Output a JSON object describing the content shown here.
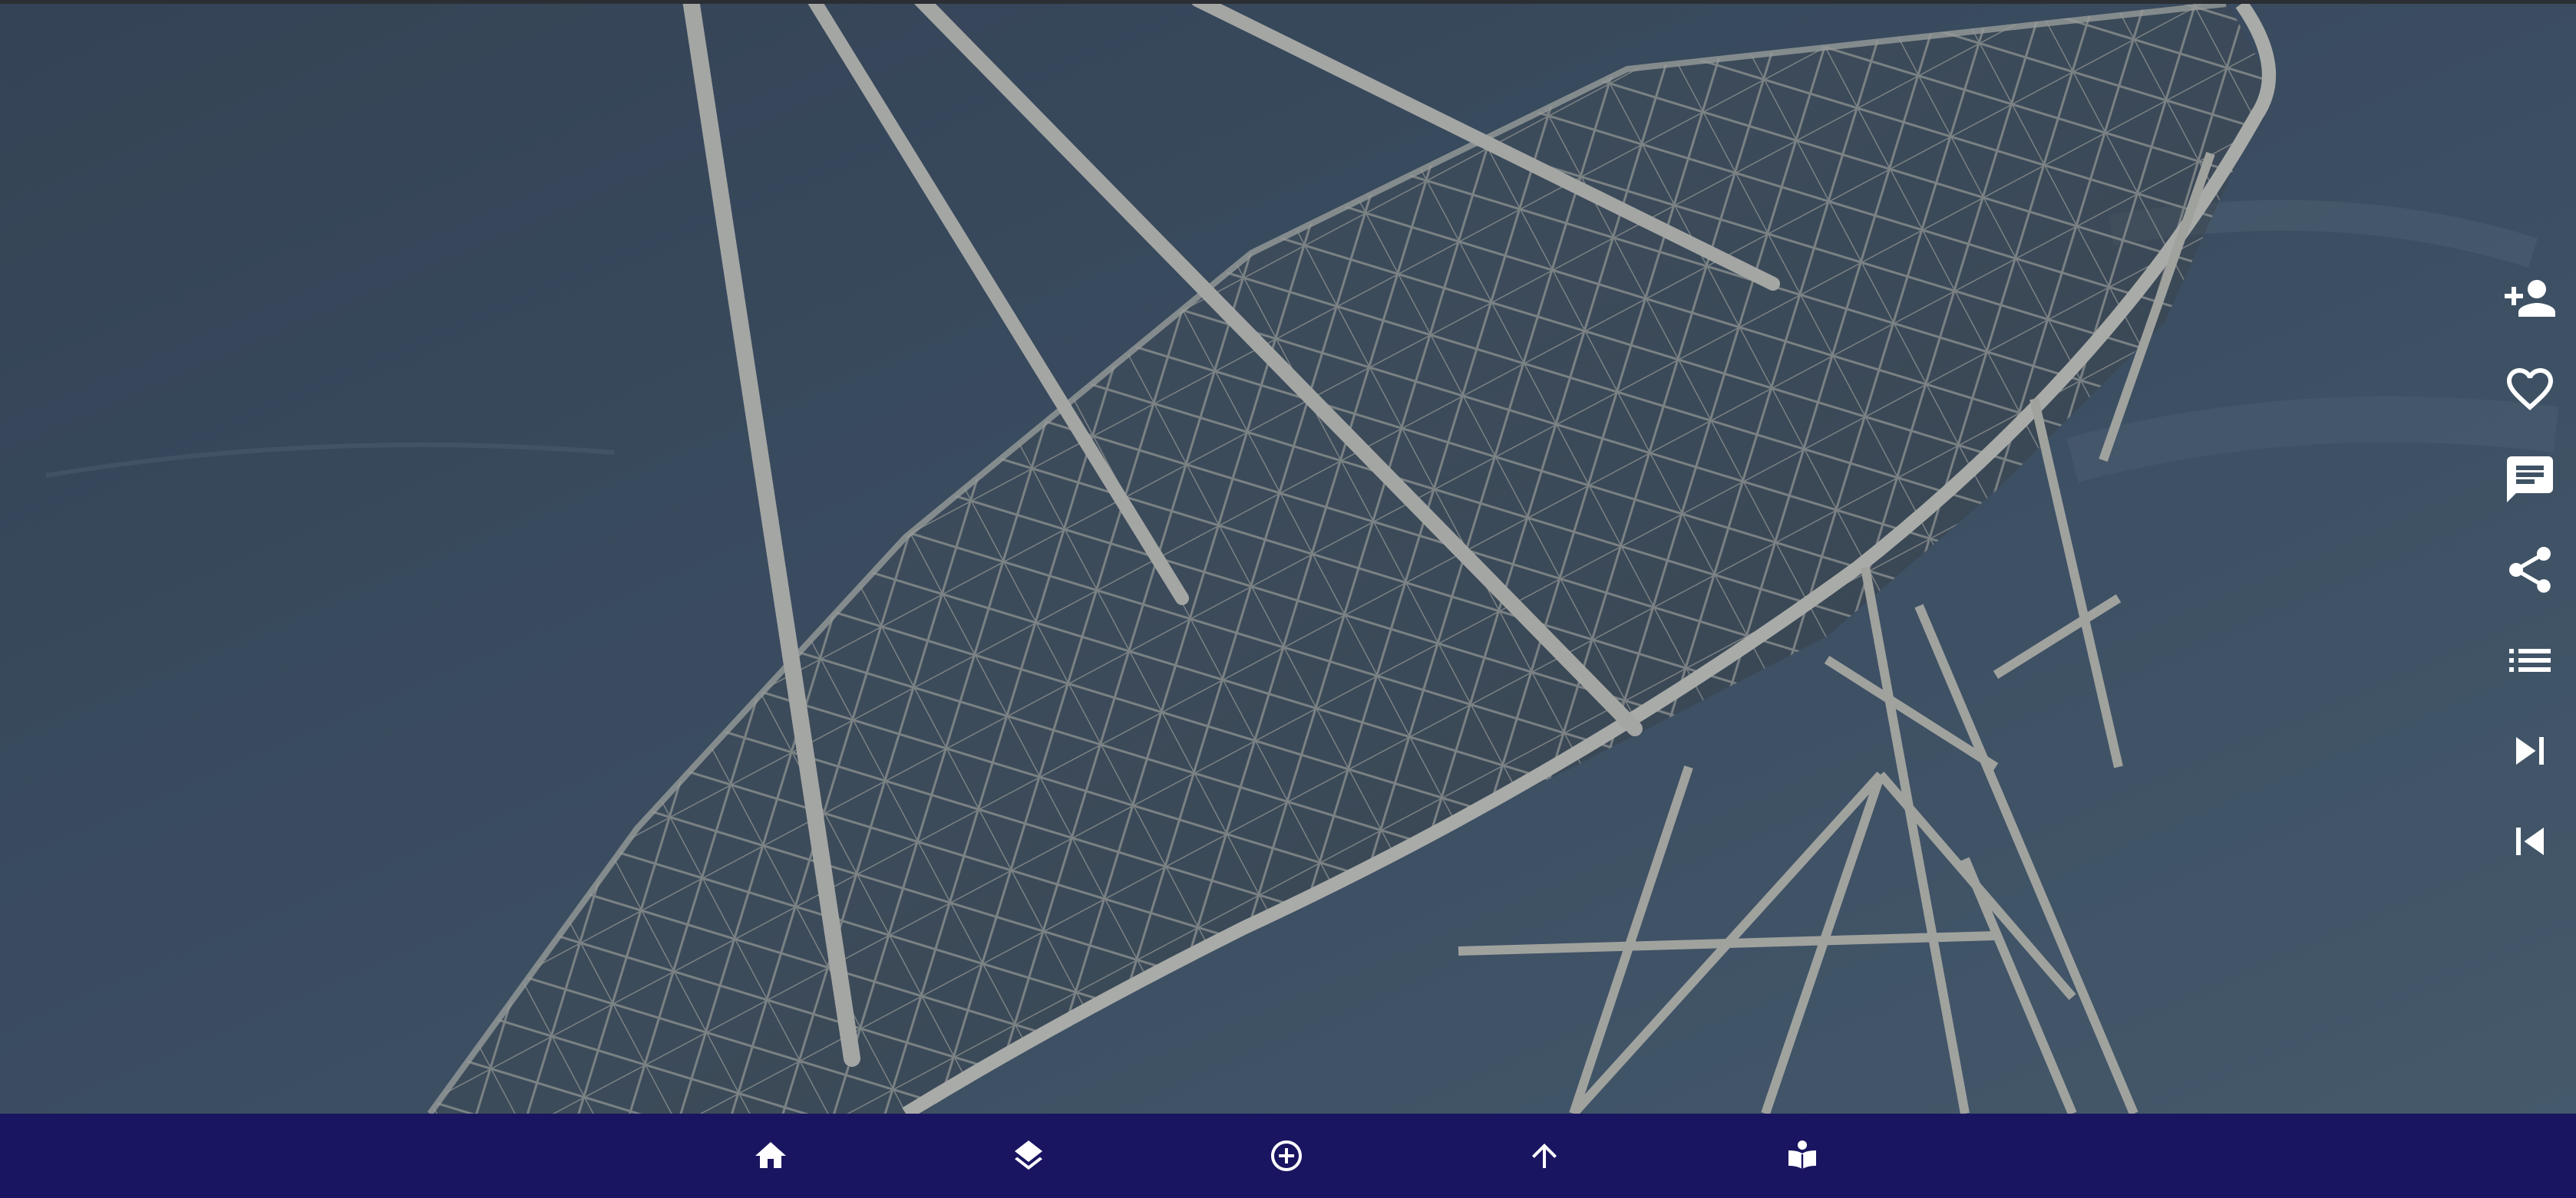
{
  "photo": {
    "subject": "radio-telescope-dish",
    "sky_color": "#3d5064",
    "structure_color": "#b9b9b4"
  },
  "right_rail": {
    "items": [
      {
        "name": "add-person",
        "icon": "person-add-icon"
      },
      {
        "name": "favorite",
        "icon": "heart-outline-icon"
      },
      {
        "name": "comment",
        "icon": "comment-icon"
      },
      {
        "name": "share",
        "icon": "share-icon"
      },
      {
        "name": "list",
        "icon": "list-icon"
      },
      {
        "name": "next",
        "icon": "skip-next-icon"
      },
      {
        "name": "previous",
        "icon": "skip-previous-icon"
      }
    ]
  },
  "bottom_nav": {
    "background": "#1a1560",
    "items": [
      {
        "name": "home",
        "icon": "home-icon"
      },
      {
        "name": "layers",
        "icon": "layers-icon"
      },
      {
        "name": "add",
        "icon": "add-circle-outline-icon"
      },
      {
        "name": "upload",
        "icon": "arrow-up-icon"
      },
      {
        "name": "read",
        "icon": "reader-icon"
      }
    ]
  },
  "colors": {
    "icon": "#ffffff",
    "nav_bar": "#1a1560"
  }
}
